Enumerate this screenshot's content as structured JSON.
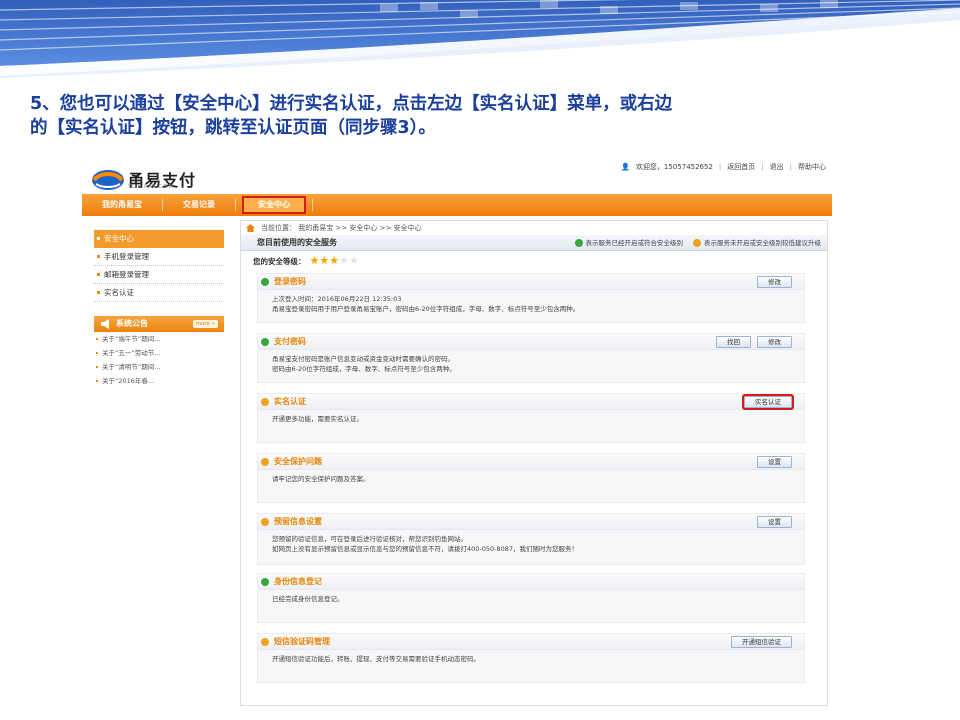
{
  "slide": {
    "title_line1": "5、您也可以通过【安全中心】进行实名认证，点击左边【实名认证】菜单，或右边",
    "title_line2": "的【实名认证】按钮，跳转至认证页面（同步骤3）。"
  },
  "header": {
    "logo_text": "甬易支付",
    "logo_sub": "YOYIPAY.COM",
    "welcome": "欢迎您，15057452652",
    "links": [
      "返回首页",
      "退出",
      "帮助中心"
    ]
  },
  "nav": {
    "items": [
      "我的甬易宝",
      "交易记录",
      "安全中心"
    ],
    "active_index": 2
  },
  "sidebar": {
    "items": [
      "安全中心",
      "手机登录管理",
      "邮箱登录管理",
      "实名认证"
    ],
    "active_index": 0,
    "notice_title": "系统公告",
    "notice_more": "more »",
    "notices": [
      "关于“端午节”期间...",
      "关于“五一”劳动节...",
      "关于“清明节”期间...",
      "关于“2016年春..."
    ]
  },
  "main": {
    "breadcrumb": "当前位置： 我的甬易宝 >> 安全中心 >> 安全中心",
    "section_title": "您目前使用的安全服务",
    "legend_on": "表示服务已经开启或符合安全级别",
    "legend_off": "表示服务未开启或安全级别较低建议升级",
    "level_label": "您的安全等级：",
    "level_stars": 3,
    "level_max": 5,
    "colors": {
      "accent": "#ee7d0a",
      "ok": "#3aa53a",
      "warn": "#f0a020",
      "highlight": "#d41c1c"
    },
    "panels": [
      {
        "title": "登录密码",
        "status": "ok",
        "lines": [
          "上次登入时间：2016年06月22日 12:35:03",
          "甬易宝登录密码用于用户登录甬易宝账户，密码由6-20位字符组成，字母、数字、标点符号至少包含两种。"
        ],
        "buttons": [
          "修改"
        ]
      },
      {
        "title": "支付密码",
        "status": "ok",
        "lines": [
          "甬易宝支付密码是账户信息变动或资金变动时需要确认的密码。",
          "密码由6-20位字符组成，字母、数字、标点符号至少包含两种。"
        ],
        "buttons": [
          "找回",
          "修改"
        ]
      },
      {
        "title": "实名认证",
        "status": "warn",
        "lines": [
          "开通更多功能，需要实名认证。"
        ],
        "buttons": [
          "实名认证"
        ]
      },
      {
        "title": "安全保护问题",
        "status": "warn",
        "lines": [
          "请牢记您的安全保护问题及答案。"
        ],
        "buttons": [
          "设置"
        ]
      },
      {
        "title": "预留信息设置",
        "status": "warn",
        "lines": [
          "您预留的验证信息，可在登录后进行验证核对，帮您识别钓鱼网站。",
          "如网页上没有显示预留信息或显示信息与您的预留信息不符，请拨打400-050-8087，我们随时为您服务！"
        ],
        "buttons": [
          "设置"
        ]
      },
      {
        "title": "身份信息登记",
        "status": "ok",
        "lines": [
          "已经完成身份信息登记。"
        ],
        "buttons": []
      },
      {
        "title": "短信验证码管理",
        "status": "warn",
        "lines": [
          "开通短信验证功能后，转账、提现、支付等交易需要验证手机动态密码。"
        ],
        "buttons": [
          "开通短信验证"
        ]
      }
    ]
  }
}
